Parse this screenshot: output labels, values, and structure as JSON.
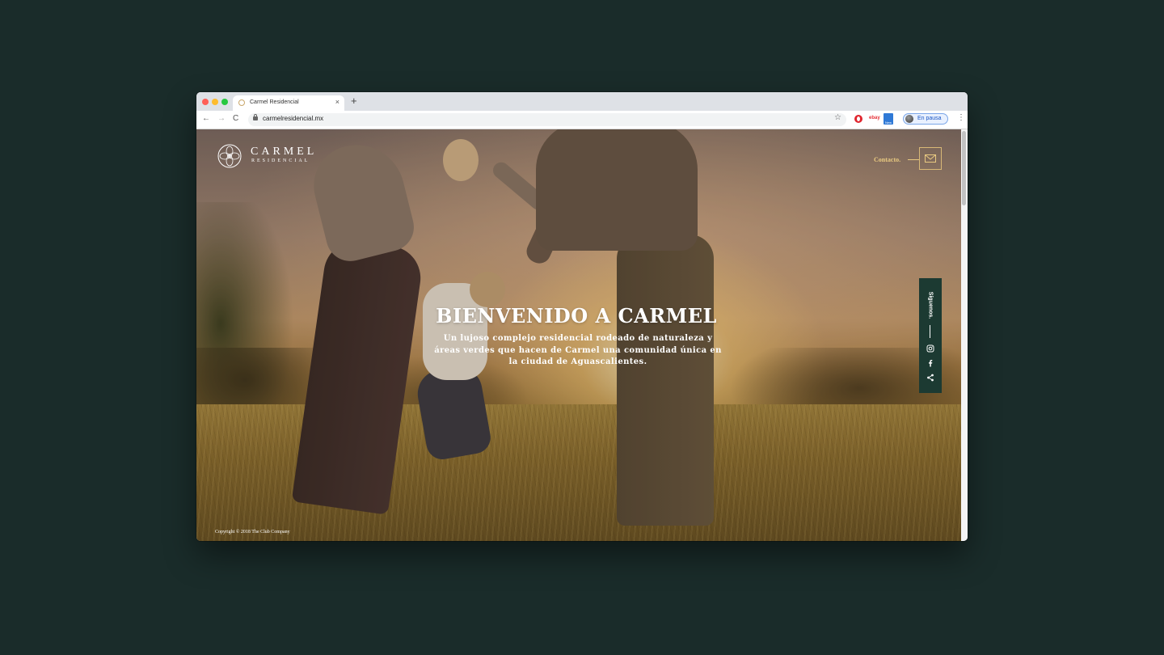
{
  "browser": {
    "tab_title": "Carmel Residencial",
    "tab_close": "×",
    "new_tab": "+",
    "back": "←",
    "forward": "→",
    "reload": "C",
    "url": "carmelresidencial.mx",
    "bookmark": "☆",
    "profile_label": "En pausa",
    "menu": "⋮",
    "ext_new_label": "New"
  },
  "site": {
    "logo_name": "CARMEL",
    "logo_sub": "RESIDENCIAL",
    "contact_label": "Contacto.",
    "hero_title": "BIENVENIDO A CARMEL",
    "hero_sub": "Un lujoso complejo residencial rodeado de naturaleza y áreas verdes que hacen de Carmel una comunidad única en la ciudad de Aguascalientes.",
    "social_label": "Síguenos.",
    "copyright": "Copyright © 2018 The Club Company"
  },
  "colors": {
    "accent_gold": "#e8c980",
    "social_bar": "#1c3a32",
    "background": "#1a2c2a"
  },
  "icons": [
    "opera-icon",
    "ebay-icon",
    "new-extension-icon",
    "mail-icon",
    "instagram-icon",
    "facebook-icon",
    "share-icon"
  ]
}
